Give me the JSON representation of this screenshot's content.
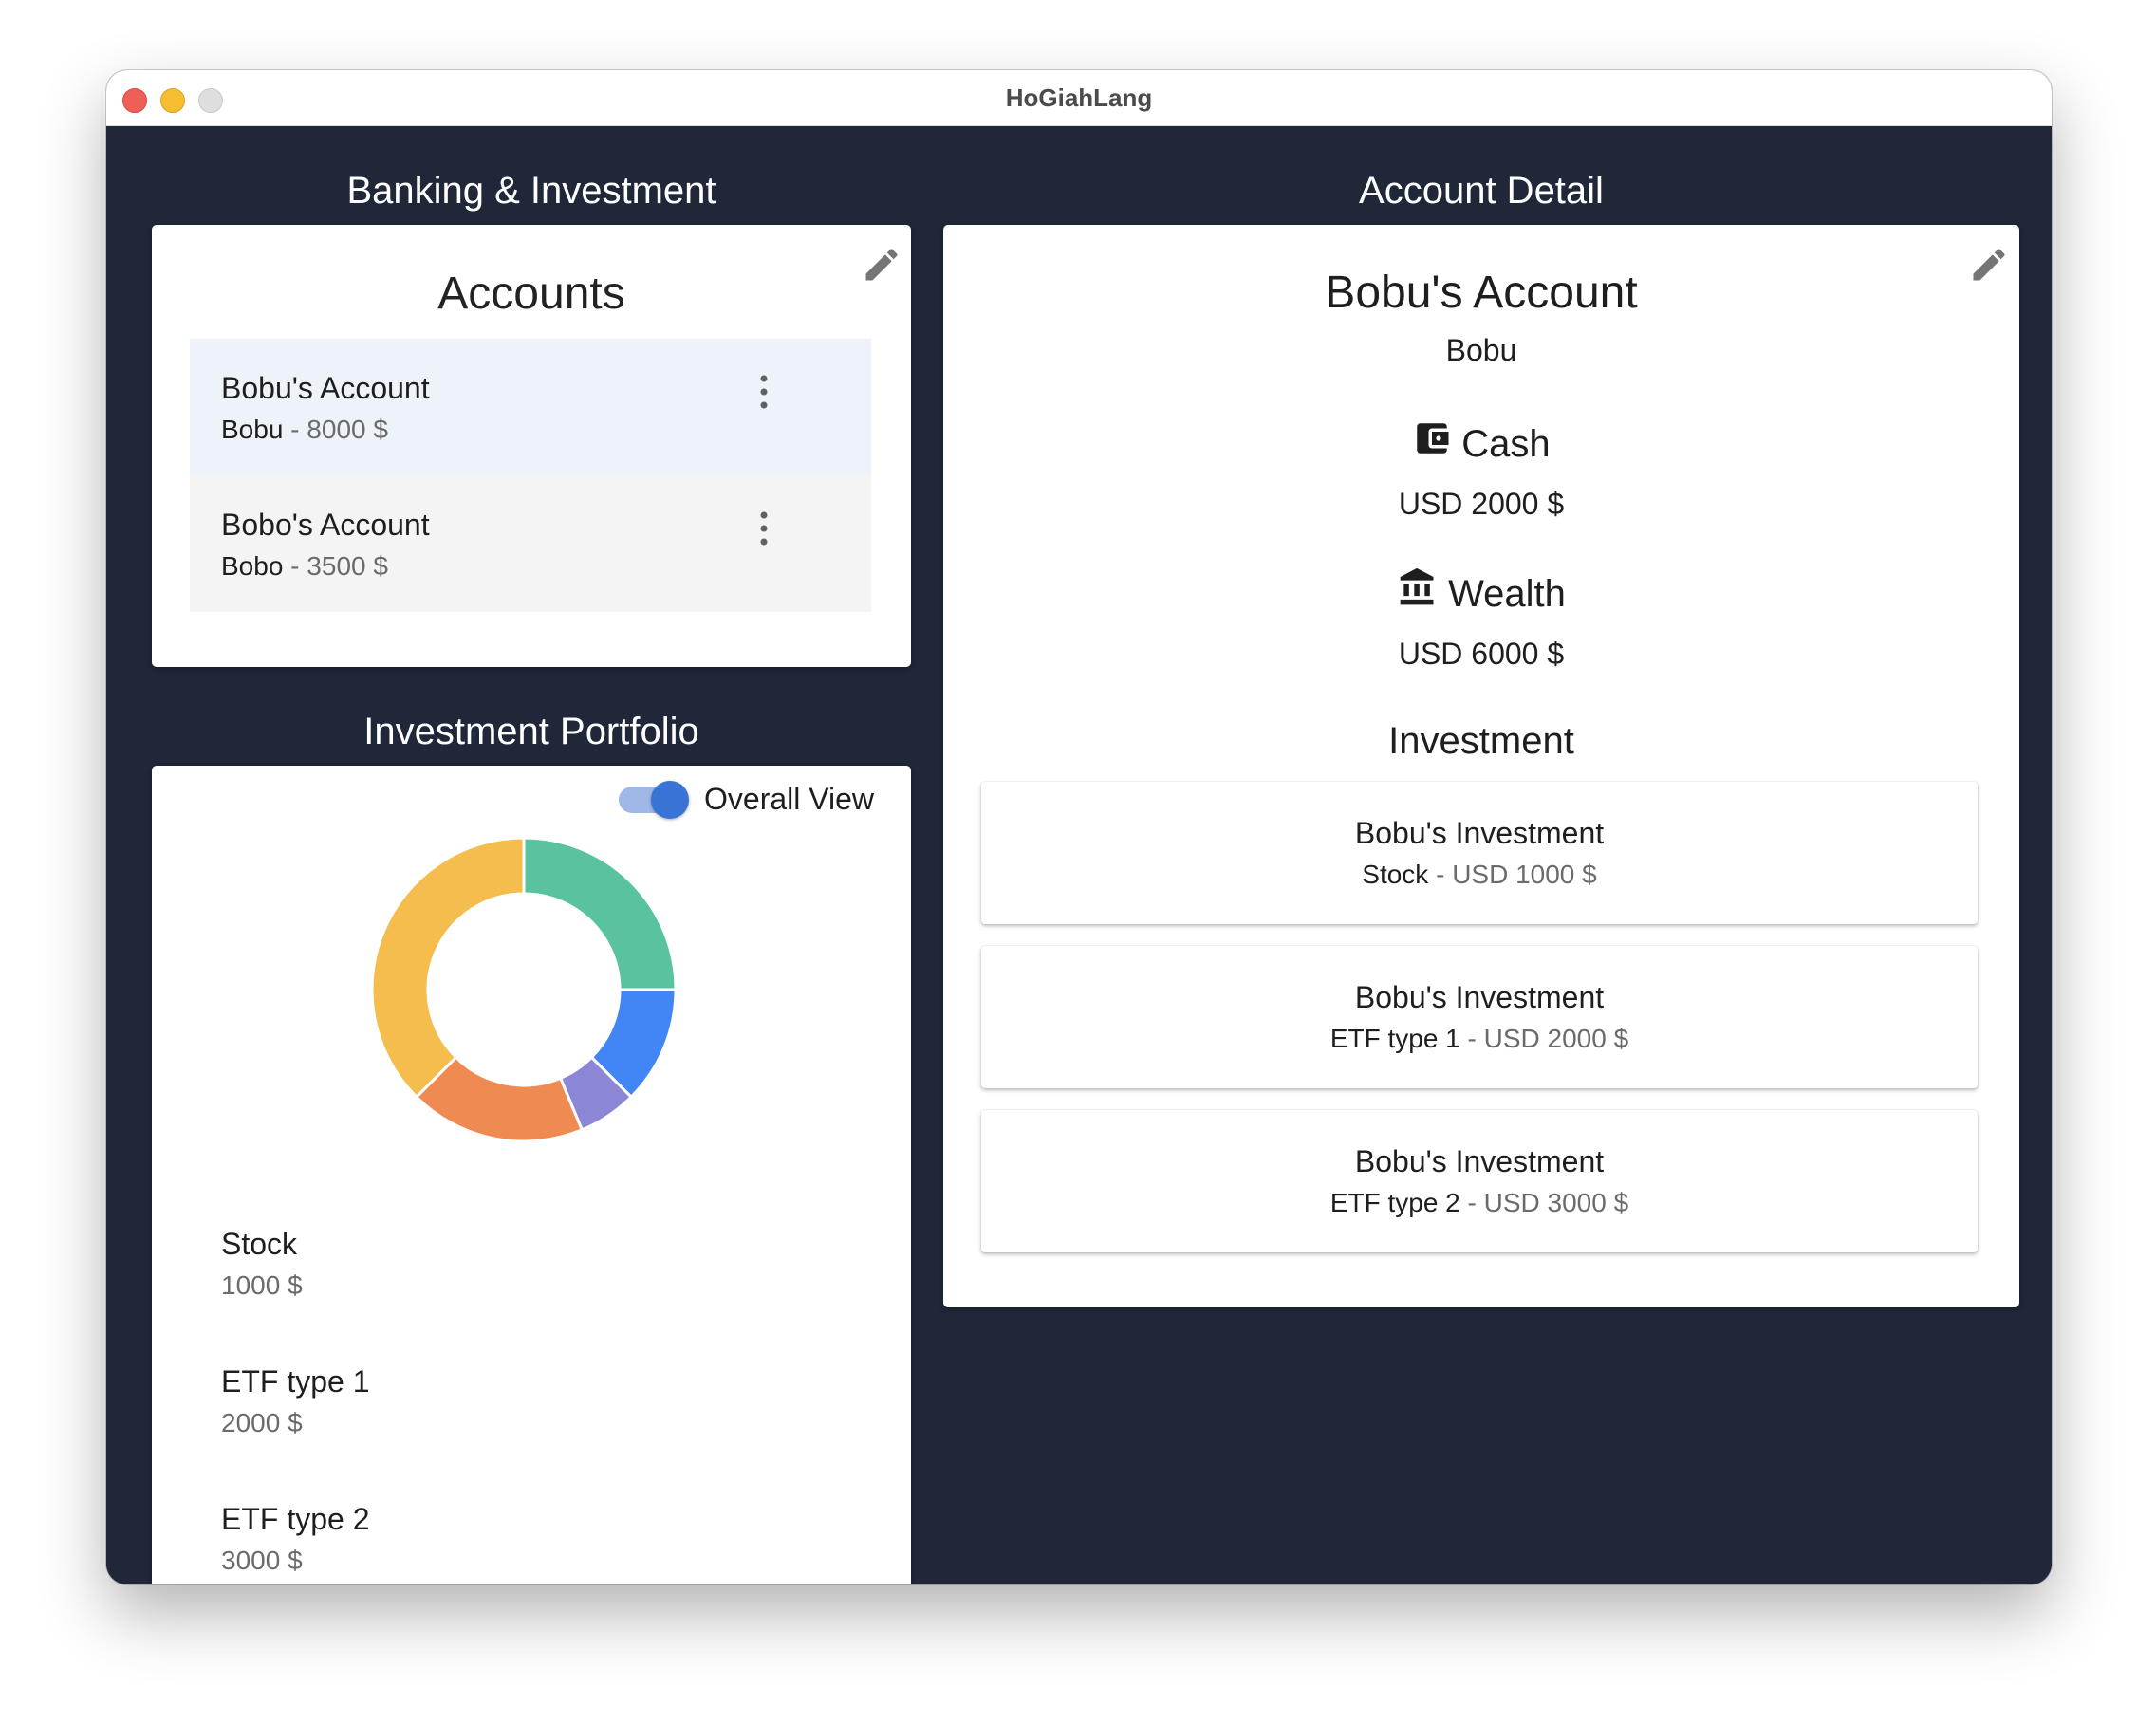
{
  "window": {
    "title": "HoGiahLang"
  },
  "left": {
    "title": "Banking & Investment",
    "accounts_card": {
      "heading": "Accounts",
      "items": [
        {
          "name": "Bobu's Account",
          "owner": "Bobu",
          "separator": " - ",
          "amount": "8000 $",
          "selected": true
        },
        {
          "name": "Bobo's Account",
          "owner": "Bobo",
          "separator": " - ",
          "amount": "3500 $",
          "selected": false
        }
      ]
    }
  },
  "portfolio": {
    "title": "Investment Portfolio",
    "toggle": {
      "label": "Overall View",
      "on": true
    },
    "legend": [
      {
        "name": "Stock",
        "value": "1000 $"
      },
      {
        "name": "ETF type 1",
        "value": "2000 $"
      },
      {
        "name": "ETF type 2",
        "value": "3000 $"
      }
    ]
  },
  "chart_data": {
    "type": "pie",
    "donut": true,
    "slices": [
      {
        "value": 1000,
        "color": "#4286f5"
      },
      {
        "value": 500,
        "color": "#8b87d6"
      },
      {
        "value": 1500,
        "color": "#ef8a52"
      },
      {
        "value": 3000,
        "color": "#f4bd4d"
      },
      {
        "value": 2000,
        "color": "#59c3a0"
      }
    ]
  },
  "detail": {
    "title": "Account Detail",
    "account_name": "Bobu's Account",
    "owner": "Bobu",
    "cash": {
      "label": "Cash",
      "value": "USD 2000 $"
    },
    "wealth": {
      "label": "Wealth",
      "value": "USD 6000 $"
    },
    "investment_heading": "Investment",
    "investments": [
      {
        "title": "Bobu's Investment",
        "type": "Stock",
        "separator": " - ",
        "amount": "USD 1000 $"
      },
      {
        "title": "Bobu's Investment",
        "type": "ETF type 1",
        "separator": " - ",
        "amount": "USD 2000 $"
      },
      {
        "title": "Bobu's Investment",
        "type": "ETF type 2",
        "separator": " - ",
        "amount": "USD 3000 $"
      }
    ]
  },
  "icons": {
    "edit": "pencil-icon",
    "more": "more-vertical-icon",
    "cash": "wallet-icon",
    "wealth": "bank-icon"
  }
}
